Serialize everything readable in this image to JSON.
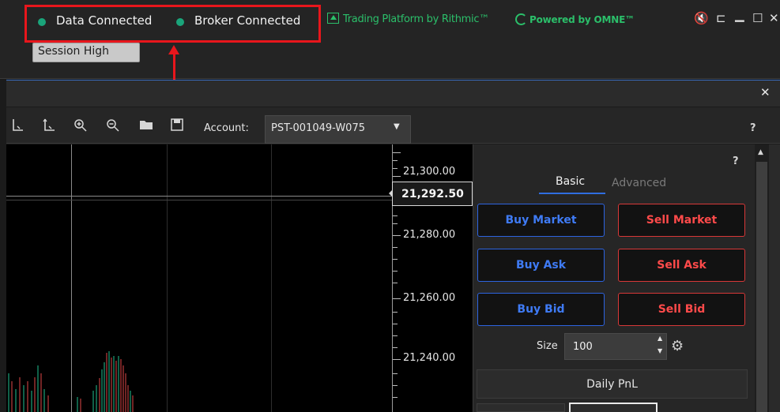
{
  "title_bar": {
    "status": {
      "data_connected": "Data Connected",
      "broker_connected": "Broker Connected",
      "connected_color": "#1aa47a"
    },
    "annotation_color": "#e8161c",
    "rithmic_text": "Trading Platform by Rithmic™",
    "omne_text": "Powered by OMNE™",
    "controls": {
      "mute_icon": "🔇",
      "pin_icon": "⊏",
      "minimize_icon": "▁",
      "maximize_icon": "☐",
      "close_icon": "✕"
    }
  },
  "panel": {
    "close_icon": "✕",
    "toolbar": {
      "account_label": "Account:",
      "account_value": "PST-001049-W075",
      "help": "?"
    }
  },
  "chart": {
    "session_high_label": "Session High",
    "current_price": "21,292.50",
    "price_labels": [
      "21,300.00",
      "21,280.00",
      "21,260.00",
      "21,240.00"
    ]
  },
  "order_panel": {
    "help": "?",
    "tabs": {
      "basic": "Basic",
      "advanced": "Advanced"
    },
    "buttons": {
      "buy_market": "Buy Market",
      "sell_market": "Sell Market",
      "buy_ask": "Buy Ask",
      "sell_ask": "Sell Ask",
      "buy_bid": "Buy Bid",
      "sell_bid": "Sell Bid"
    },
    "size_label": "Size",
    "size_value": "100",
    "daily_pnl": "Daily PnL"
  },
  "colors": {
    "buy": "#3f7bf5",
    "sell": "#ff4a4a",
    "accent": "#2f6ee0",
    "brand_green": "#2bbf6a"
  }
}
